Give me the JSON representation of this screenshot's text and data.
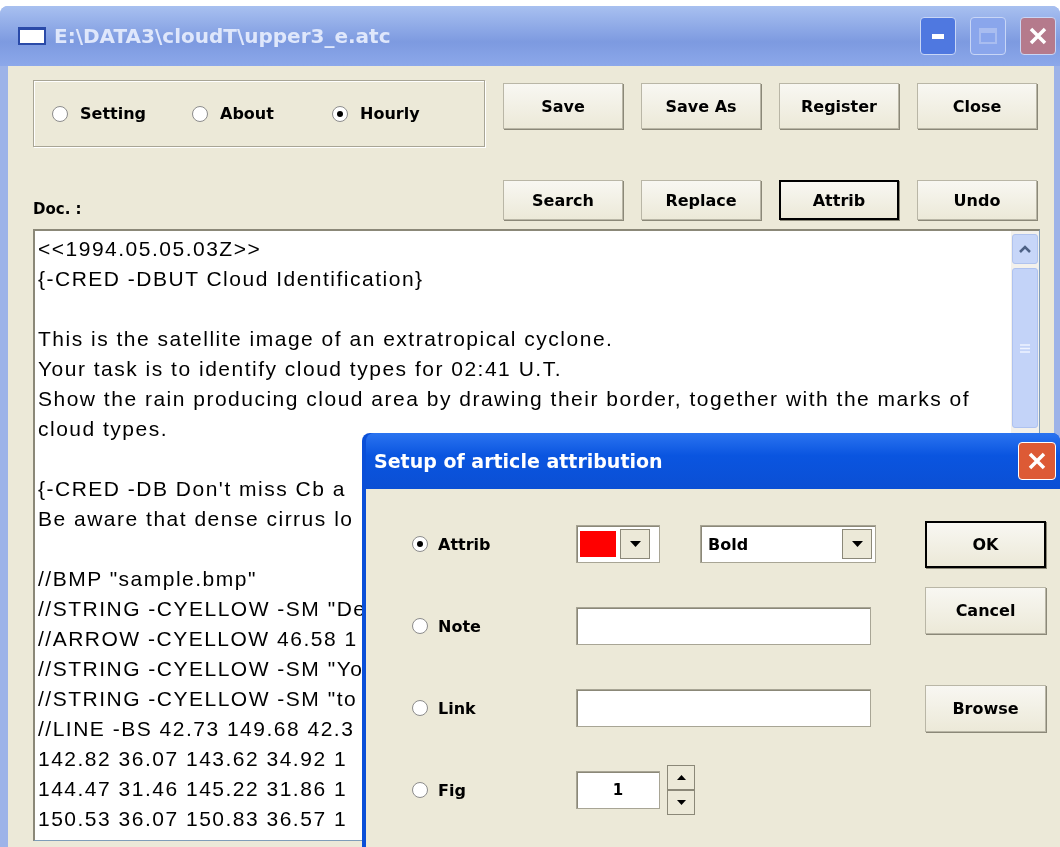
{
  "window": {
    "title": "E:\\DATA3\\cloudT\\upper3_e.atc",
    "active": false
  },
  "modes": [
    {
      "label": "Setting",
      "selected": false
    },
    {
      "label": "About",
      "selected": false
    },
    {
      "label": "Hourly",
      "selected": true
    }
  ],
  "buttons_top": [
    {
      "label": "Save",
      "default": false
    },
    {
      "label": "Save As",
      "default": false
    },
    {
      "label": "Register",
      "default": false
    },
    {
      "label": "Close",
      "default": false
    }
  ],
  "buttons_bottom": [
    {
      "label": "Search",
      "default": false
    },
    {
      "label": "Replace",
      "default": false
    },
    {
      "label": "Attrib",
      "default": true
    },
    {
      "label": "Undo",
      "default": false
    }
  ],
  "doc": {
    "label": "Doc. :",
    "blocks": [
      [
        "<<1994.05.05.03Z>>",
        "{-CRED -DBUT Cloud Identification}"
      ],
      [
        "This is the satellite image of an extratropical cyclone.",
        "Your task is to identify cloud types for 02:41 U.T.",
        "Show the rain producing cloud area by drawing their border, together with the marks of",
        "cloud types."
      ],
      [
        "{-CRED -DB Don't miss Cb a",
        "Be aware that dense cirrus lo"
      ],
      [
        "//BMP \"sample.bmp\"",
        "//STRING -CYELLOW -SM \"De",
        "//ARROW -CYELLOW 46.58 1",
        "//STRING -CYELLOW -SM \"Yo",
        "//STRING -CYELLOW -SM \"to",
        "//LINE -BS 42.73 149.68 42.3",
        "142.82 36.07 143.62 34.92 1",
        "144.47 31.46 145.22 31.86 1",
        "150.53 36.07 150.83 36.57 1"
      ]
    ]
  },
  "dialog": {
    "title": "Setup of article attribution",
    "active": true,
    "rows": [
      {
        "kind": "attrib",
        "label": "Attrib",
        "selected": true,
        "color": "#ff0000",
        "style": "Bold"
      },
      {
        "kind": "text",
        "label": "Note",
        "selected": false
      },
      {
        "kind": "text",
        "label": "Link",
        "selected": false
      },
      {
        "kind": "spin",
        "label": "Fig",
        "selected": false,
        "value": "1"
      }
    ],
    "buttons": [
      {
        "label": "OK",
        "default": true
      },
      {
        "label": "Cancel",
        "default": false
      },
      {
        "label": "Browse",
        "default": false
      }
    ]
  }
}
